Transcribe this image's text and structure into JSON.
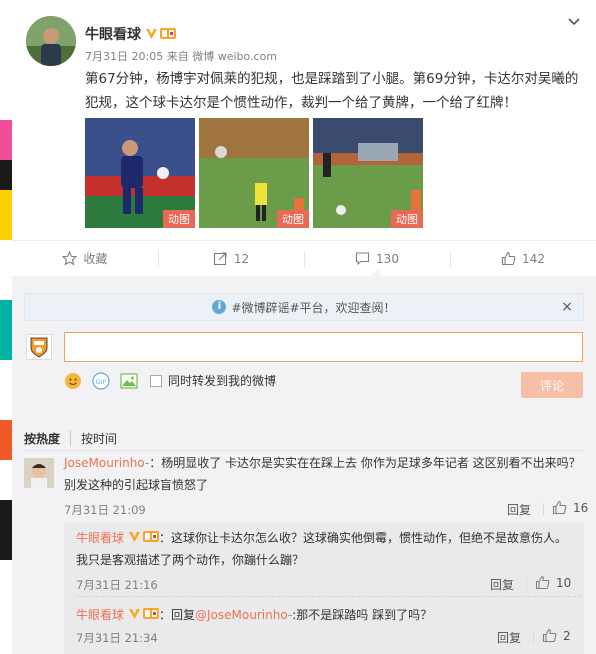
{
  "post": {
    "author": "牛眼看球",
    "time": "7月31日 20:05",
    "source": "来自 微博 weibo.com",
    "text": "第67分钟，杨博宇对佩莱的犯规，也是踩踏到了小腿。第69分钟，卡达尔对吴曦的犯规，这个球卡达尔是个惯性动作，裁判一个给了黄牌，一个给了红牌！",
    "gif_label": "动图",
    "actions": {
      "favorite": "收藏",
      "repost_count": "12",
      "comment_count": "130",
      "like_count": "142"
    }
  },
  "comment_area": {
    "notice": "#微博辟谣#平台，欢迎查阅！",
    "notice_close": "×",
    "forward_label": "同时转发到我的微博",
    "submit_label": "评论",
    "sort_hot": "按热度",
    "sort_time": "按时间",
    "comments": [
      {
        "user": "JoseMourinho-",
        "text_line1": "：杨明显收了 卡达尔是实实在在踩上去 你作为足球多年记者 这区别看不出来吗？",
        "text_line2": "别发这种的引起球盲愤怒了",
        "time": "7月31日 21:09",
        "reply": "回复",
        "likes": "16"
      }
    ],
    "sub_comments": [
      {
        "user": "牛眼看球",
        "text_line1": "：这球你让卡达尔怎么收？这球确实他倒霉，惯性动作，但绝不是故意伤人。",
        "text_line2": "我只是客观描述了两个动作，你蹦什么蹦？",
        "time": "7月31日 21:16",
        "reply": "回复",
        "likes": "10"
      },
      {
        "user": "牛眼看球",
        "text_prefix": "：回复",
        "mention": "@JoseMourinho-",
        "text_suffix": ":那不是踩踏吗 踩到了吗？",
        "time": "7月31日 21:34",
        "reply": "回复",
        "likes": "2"
      }
    ]
  },
  "colors": {
    "accent": "#eb7350",
    "submit_disabled": "#f7bfa7",
    "input_border": "#f0a35a",
    "verified_badge": "#f6a623"
  }
}
